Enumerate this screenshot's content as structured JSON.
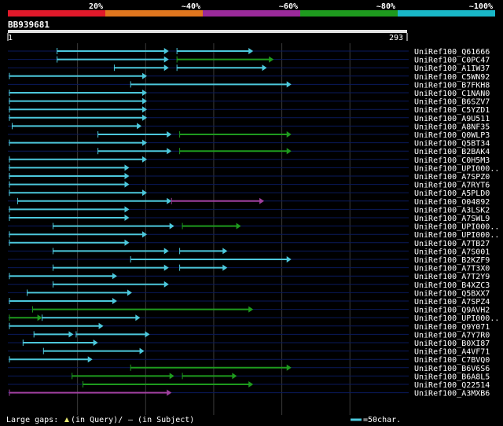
{
  "colors": {
    "background": "#000000",
    "grid": "#3a3a3a",
    "row_line": "#0a1a5c",
    "scale_bar": "#e0e0e0",
    "hit_cyan": "#4cc8dc",
    "hit_green": "#1e9a1e",
    "hit_purple": "#a040a0",
    "text": "#ffffff",
    "gap_marker": "#e8e870"
  },
  "legend_scale": {
    "bands": [
      {
        "label": "20%",
        "color": "#e0192a"
      },
      {
        "label": "~40%",
        "color": "#e0761e"
      },
      {
        "label": "~60%",
        "color": "#9a2a9a"
      },
      {
        "label": "~80%",
        "color": "#1e9a1e"
      },
      {
        "label": "~100%",
        "color": "#19b7c8"
      }
    ]
  },
  "query": {
    "id": "BB939681",
    "start_label": "1",
    "end_label": "293"
  },
  "hits": [
    {
      "name": "UniRef100_Q61666",
      "segments": [
        {
          "s": 36,
          "e": 118,
          "c": "cyan"
        },
        {
          "s": 124,
          "e": 180,
          "c": "cyan"
        }
      ]
    },
    {
      "name": "UniRef100_C0PC47",
      "segments": [
        {
          "s": 36,
          "e": 118,
          "c": "cyan"
        },
        {
          "s": 124,
          "e": 195,
          "c": "green"
        }
      ]
    },
    {
      "name": "UniRef100_A1IW37",
      "segments": [
        {
          "s": 78,
          "e": 118,
          "c": "cyan"
        },
        {
          "s": 124,
          "e": 190,
          "c": "cyan"
        }
      ]
    },
    {
      "name": "UniRef100_C5WN92",
      "segments": [
        {
          "s": 1,
          "e": 102,
          "c": "cyan"
        }
      ]
    },
    {
      "name": "UniRef100_B7FKH8",
      "segments": [
        {
          "s": 90,
          "e": 208,
          "c": "cyan"
        }
      ]
    },
    {
      "name": "UniRef100_C1NAN0",
      "segments": [
        {
          "s": 1,
          "e": 102,
          "c": "cyan"
        }
      ]
    },
    {
      "name": "UniRef100_B6SZV7",
      "segments": [
        {
          "s": 1,
          "e": 102,
          "c": "cyan"
        }
      ]
    },
    {
      "name": "UniRef100_C5YZD1",
      "segments": [
        {
          "s": 1,
          "e": 102,
          "c": "cyan"
        }
      ]
    },
    {
      "name": "UniRef100_A9U511",
      "segments": [
        {
          "s": 1,
          "e": 102,
          "c": "cyan"
        }
      ]
    },
    {
      "name": "UniRef100_A8NF35",
      "segments": [
        {
          "s": 3,
          "e": 98,
          "c": "cyan"
        }
      ]
    },
    {
      "name": "UniRef100_Q0WLP3",
      "segments": [
        {
          "s": 66,
          "e": 120,
          "c": "cyan"
        },
        {
          "s": 126,
          "e": 208,
          "c": "green"
        }
      ]
    },
    {
      "name": "UniRef100_Q5BT34",
      "segments": [
        {
          "s": 1,
          "e": 102,
          "c": "cyan"
        }
      ]
    },
    {
      "name": "UniRef100_B2BAK4",
      "segments": [
        {
          "s": 66,
          "e": 120,
          "c": "cyan"
        },
        {
          "s": 126,
          "e": 208,
          "c": "green"
        }
      ]
    },
    {
      "name": "UniRef100_C0H5M3",
      "segments": [
        {
          "s": 1,
          "e": 102,
          "c": "cyan"
        }
      ]
    },
    {
      "name": "UniRef100_UPI000..",
      "segments": [
        {
          "s": 1,
          "e": 89,
          "c": "cyan"
        }
      ]
    },
    {
      "name": "UniRef100_A7SPZ0",
      "segments": [
        {
          "s": 1,
          "e": 89,
          "c": "cyan"
        }
      ]
    },
    {
      "name": "UniRef100_A7RYT6",
      "segments": [
        {
          "s": 1,
          "e": 89,
          "c": "cyan"
        }
      ]
    },
    {
      "name": "UniRef100_A5PLD0",
      "segments": [
        {
          "s": 1,
          "e": 102,
          "c": "cyan"
        }
      ]
    },
    {
      "name": "UniRef100_O04892",
      "segments": [
        {
          "s": 7,
          "e": 120,
          "c": "cyan"
        },
        {
          "s": 120,
          "e": 188,
          "c": "purple"
        }
      ]
    },
    {
      "name": "UniRef100_A3LSK2",
      "segments": [
        {
          "s": 1,
          "e": 89,
          "c": "cyan"
        }
      ]
    },
    {
      "name": "UniRef100_A7SWL9",
      "segments": [
        {
          "s": 1,
          "e": 89,
          "c": "cyan"
        }
      ]
    },
    {
      "name": "UniRef100_UPI000..",
      "segments": [
        {
          "s": 33,
          "e": 122,
          "c": "cyan"
        },
        {
          "s": 128,
          "e": 171,
          "c": "green"
        }
      ]
    },
    {
      "name": "UniRef100_UPI000..",
      "segments": [
        {
          "s": 1,
          "e": 102,
          "c": "cyan"
        }
      ]
    },
    {
      "name": "UniRef100_A7TB27",
      "segments": [
        {
          "s": 1,
          "e": 89,
          "c": "cyan"
        }
      ]
    },
    {
      "name": "UniRef100_A7S001",
      "segments": [
        {
          "s": 33,
          "e": 118,
          "c": "cyan"
        },
        {
          "s": 126,
          "e": 161,
          "c": "cyan"
        }
      ]
    },
    {
      "name": "UniRef100_B2KZF9",
      "segments": [
        {
          "s": 90,
          "e": 208,
          "c": "cyan"
        }
      ]
    },
    {
      "name": "UniRef100_A7T3X0",
      "segments": [
        {
          "s": 33,
          "e": 118,
          "c": "cyan"
        },
        {
          "s": 126,
          "e": 161,
          "c": "cyan"
        }
      ]
    },
    {
      "name": "UniRef100_A7T2Y9",
      "segments": [
        {
          "s": 1,
          "e": 80,
          "c": "cyan"
        }
      ]
    },
    {
      "name": "UniRef100_B4XZC3",
      "segments": [
        {
          "s": 33,
          "e": 118,
          "c": "cyan"
        }
      ]
    },
    {
      "name": "UniRef100_Q5BXX7",
      "segments": [
        {
          "s": 14,
          "e": 91,
          "c": "cyan"
        }
      ]
    },
    {
      "name": "UniRef100_A7SPZ4",
      "segments": [
        {
          "s": 1,
          "e": 80,
          "c": "cyan"
        }
      ]
    },
    {
      "name": "UniRef100_Q9AVH2",
      "segments": [
        {
          "s": 18,
          "e": 180,
          "c": "green"
        }
      ]
    },
    {
      "name": "UniRef100_UPI000..",
      "segments": [
        {
          "s": 1,
          "e": 25,
          "c": "green"
        },
        {
          "s": 25,
          "e": 97,
          "c": "cyan"
        }
      ]
    },
    {
      "name": "UniRef100_Q9Y071",
      "segments": [
        {
          "s": 1,
          "e": 70,
          "c": "cyan"
        }
      ]
    },
    {
      "name": "UniRef100_A7Y7R0",
      "segments": [
        {
          "s": 19,
          "e": 48,
          "c": "cyan"
        },
        {
          "s": 50,
          "e": 104,
          "c": "cyan"
        }
      ]
    },
    {
      "name": "UniRef100_B0XI87",
      "segments": [
        {
          "s": 11,
          "e": 66,
          "c": "cyan"
        }
      ]
    },
    {
      "name": "UniRef100_A4VF71",
      "segments": [
        {
          "s": 26,
          "e": 100,
          "c": "cyan"
        }
      ]
    },
    {
      "name": "UniRef100_C7BVQ0",
      "segments": [
        {
          "s": 1,
          "e": 62,
          "c": "cyan"
        }
      ]
    },
    {
      "name": "UniRef100_B6V6S6",
      "segments": [
        {
          "s": 90,
          "e": 208,
          "c": "green"
        }
      ]
    },
    {
      "name": "UniRef100_B6A8L5",
      "segments": [
        {
          "s": 47,
          "e": 122,
          "c": "green"
        },
        {
          "s": 128,
          "e": 168,
          "c": "green"
        }
      ]
    },
    {
      "name": "UniRef100_Q22514",
      "segments": [
        {
          "s": 55,
          "e": 180,
          "c": "green"
        }
      ]
    },
    {
      "name": "UniRef100_A3MXB6",
      "segments": [
        {
          "s": 1,
          "e": 120,
          "c": "purple"
        }
      ]
    }
  ],
  "footer": {
    "gaps_label": "Large gaps:",
    "in_query": "(in Query)/",
    "in_subject": "– (in Subject)",
    "scale_legend": "=50char."
  }
}
